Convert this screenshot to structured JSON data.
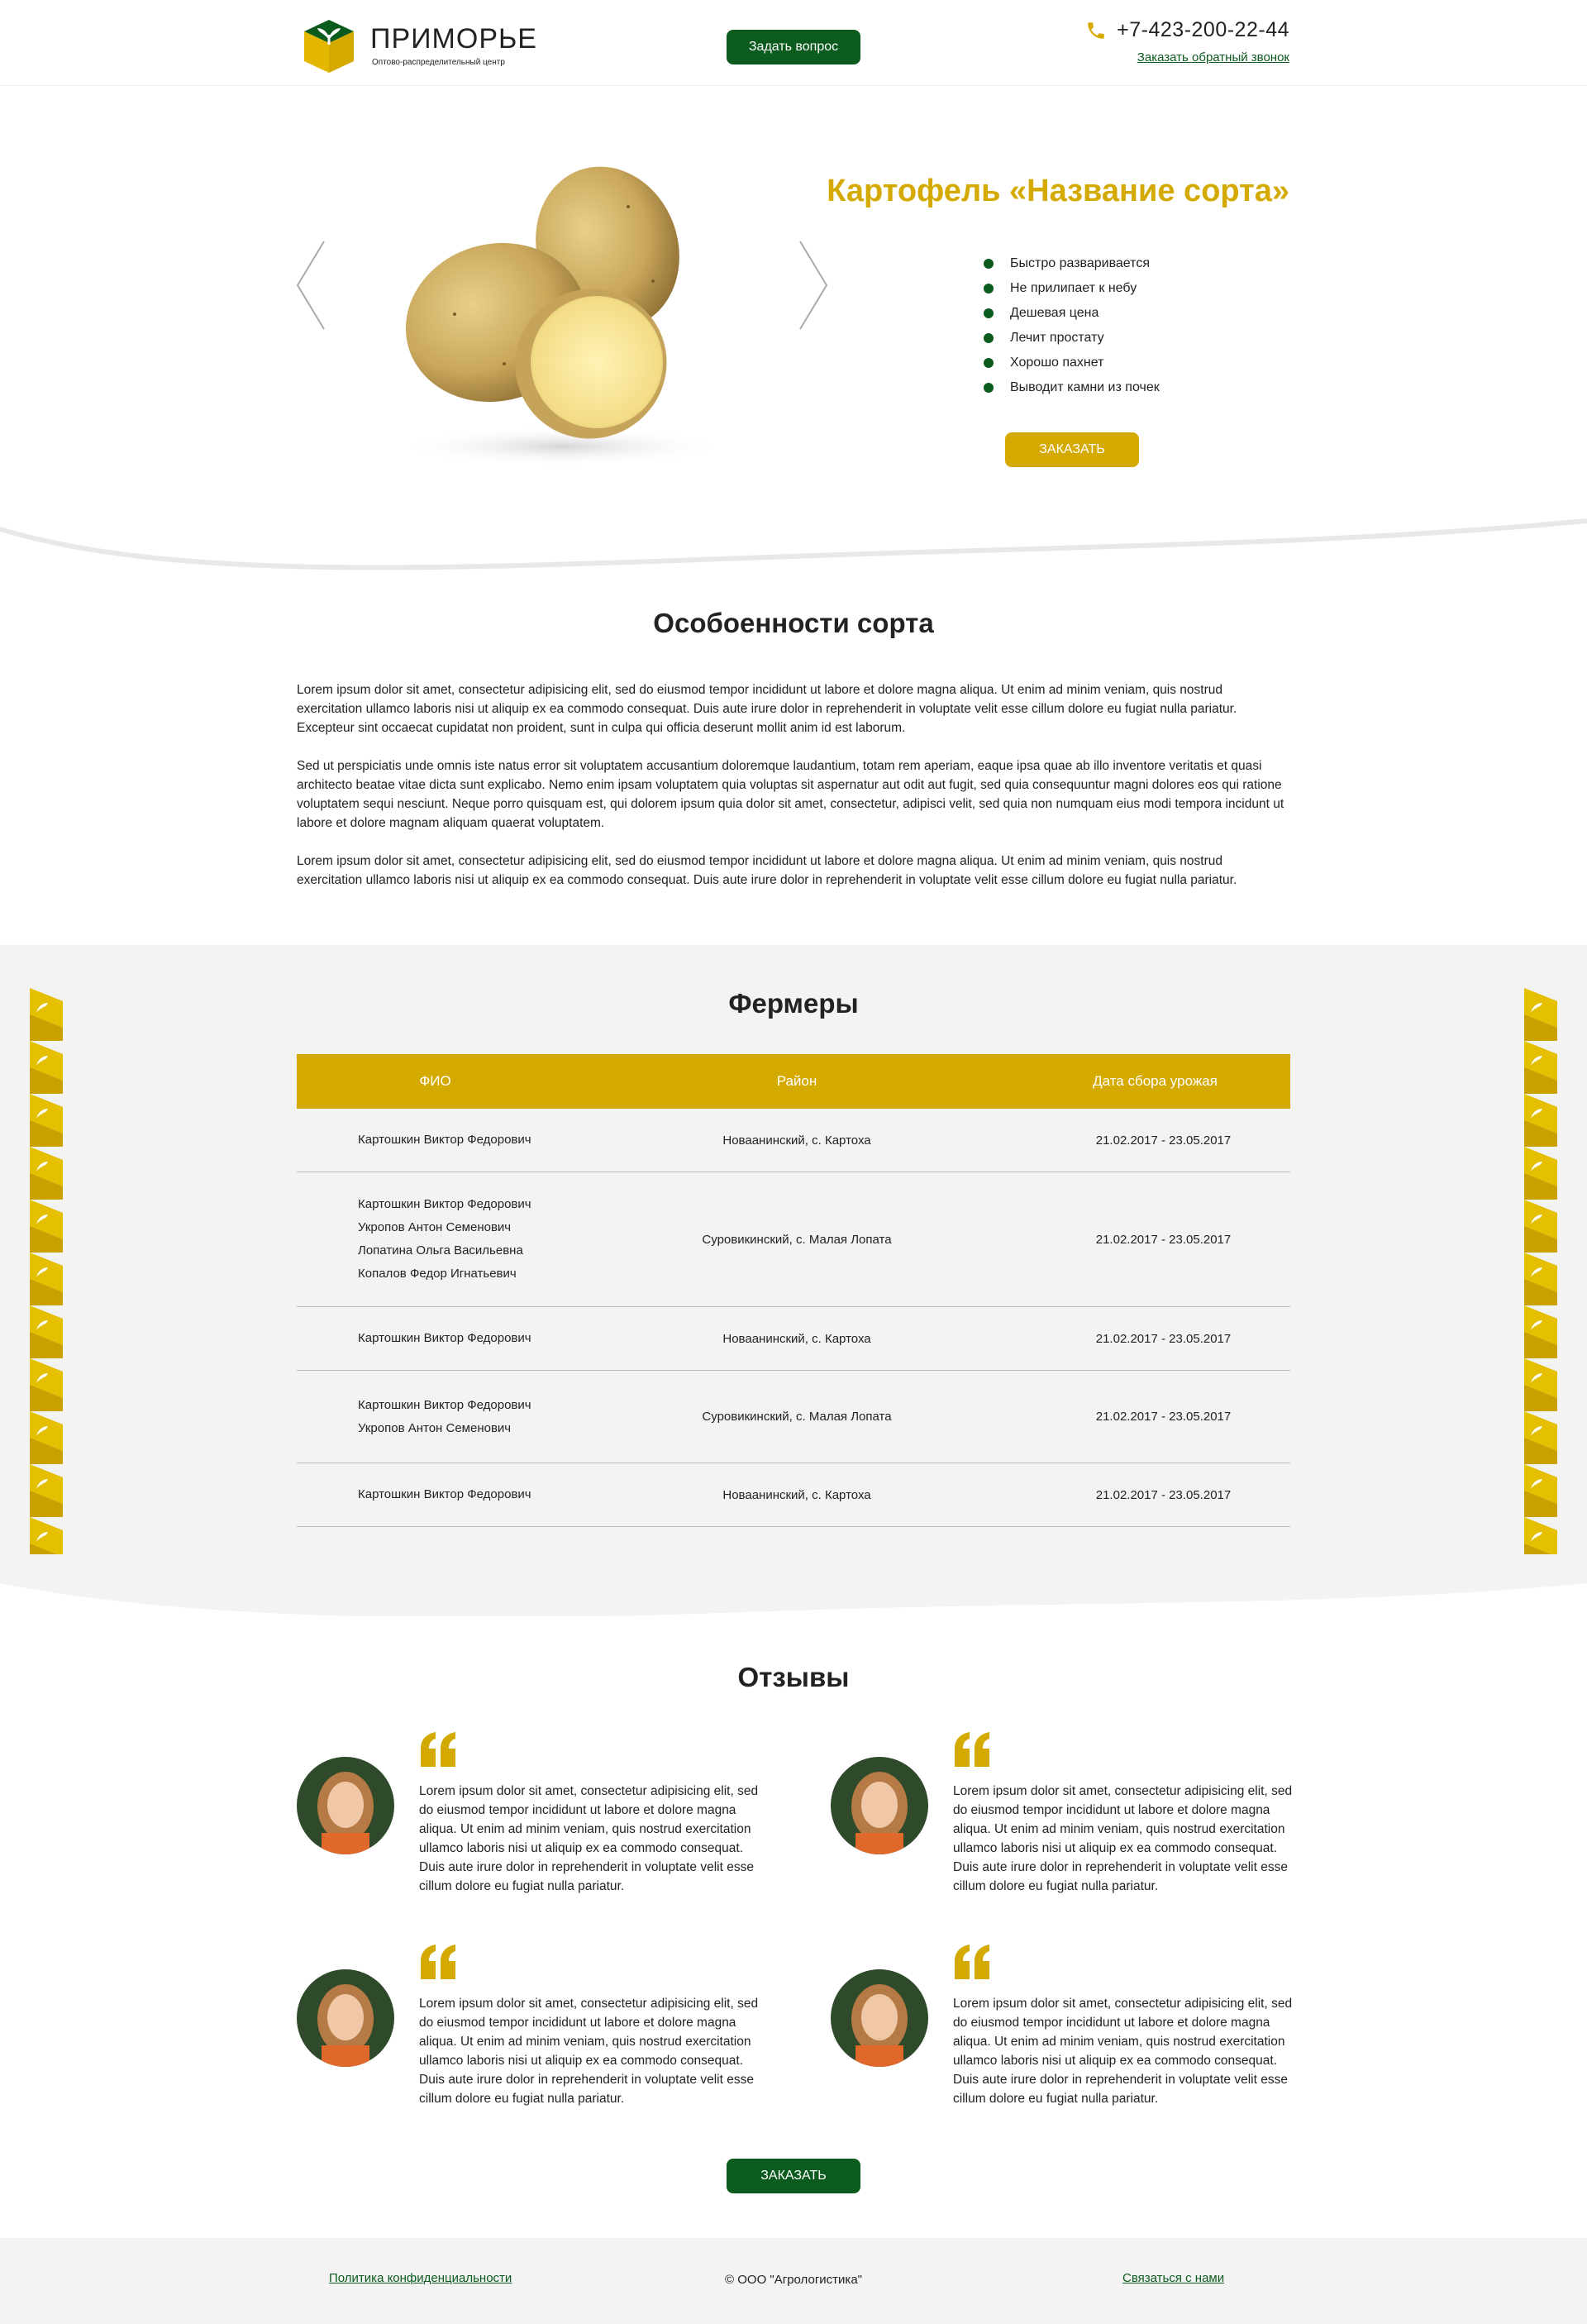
{
  "header": {
    "logo_title": "ПРИМОРЬЕ",
    "logo_subtitle": "Оптово-распределительный центр",
    "ask_button": "Задать вопрос",
    "phone": "+7-423-200-22-44",
    "callback_link": "Заказать обратный звонок"
  },
  "hero": {
    "title": "Картофель «Название сорта»",
    "features": [
      "Быстро разваривается",
      "Не прилипает к небу",
      "Дешевая цена",
      "Лечит простату",
      "Хорошо пахнет",
      "Выводит камни из почек"
    ],
    "order_button": "ЗАКАЗАТЬ"
  },
  "variety": {
    "title": "Особоенности сорта",
    "paragraphs": [
      "Lorem ipsum dolor sit amet, consectetur adipisicing elit, sed do eiusmod tempor incididunt ut labore et dolore magna aliqua. Ut enim ad minim veniam, quis nostrud exercitation ullamco laboris nisi ut aliquip ex ea commodo consequat. Duis aute irure dolor in reprehenderit in voluptate velit esse cillum dolore eu fugiat nulla pariatur. Excepteur sint occaecat cupidatat non proident, sunt in culpa qui officia deserunt mollit anim id est laborum.",
      "Sed ut perspiciatis unde omnis iste natus error sit voluptatem accusantium doloremque laudantium, totam rem aperiam, eaque ipsa quae ab illo inventore veritatis et quasi architecto beatae vitae dicta sunt explicabo. Nemo enim ipsam voluptatem quia voluptas sit aspernatur aut odit aut fugit, sed quia consequuntur magni dolores eos qui ratione voluptatem sequi nesciunt. Neque porro quisquam est, qui dolorem ipsum quia dolor sit amet, consectetur, adipisci velit, sed quia non numquam eius modi tempora incidunt ut labore et dolore magnam aliquam quaerat voluptatem.",
      "Lorem ipsum dolor sit amet, consectetur adipisicing elit, sed do eiusmod tempor incididunt ut labore et dolore magna aliqua. Ut enim ad minim veniam, quis nostrud exercitation ullamco laboris nisi ut aliquip ex ea commodo consequat. Duis aute irure dolor in reprehenderit in voluptate velit esse cillum dolore eu fugiat nulla pariatur."
    ]
  },
  "farmers": {
    "title": "Фермеры",
    "columns": [
      "ФИО",
      "Район",
      "Дата сбора урожая"
    ],
    "rows": [
      {
        "names": [
          "Картошкин Виктор Федорович"
        ],
        "district": "Новаанинский, с. Картоха",
        "dates": "21.02.2017 - 23.05.2017"
      },
      {
        "names": [
          "Картошкин Виктор Федорович",
          "Укропов Антон Семенович",
          "Лопатина Ольга Васильевна",
          "Копалов Федор Игнатьевич"
        ],
        "district": "Суровикинский, с. Малая Лопата",
        "dates": "21.02.2017 - 23.05.2017"
      },
      {
        "names": [
          "Картошкин Виктор Федорович"
        ],
        "district": "Новаанинский, с. Картоха",
        "dates": "21.02.2017 - 23.05.2017"
      },
      {
        "names": [
          "Картошкин Виктор Федорович",
          "Укропов Антон Семенович"
        ],
        "district": "Суровикинский, с. Малая Лопата",
        "dates": "21.02.2017 - 23.05.2017"
      },
      {
        "names": [
          "Картошкин Виктор Федорович"
        ],
        "district": "Новаанинский, с. Картоха",
        "dates": "21.02.2017 - 23.05.2017"
      }
    ]
  },
  "reviews": {
    "title": "Отзывы",
    "items": [
      {
        "text": "Lorem ipsum dolor sit amet, consectetur adipisicing elit, sed do eiusmod tempor incididunt ut labore et dolore magna aliqua. Ut enim ad minim veniam, quis nostrud exercitation ullamco laboris nisi ut aliquip ex ea commodo consequat. Duis aute irure dolor in reprehenderit in voluptate velit esse cillum dolore eu fugiat nulla pariatur."
      },
      {
        "text": "Lorem ipsum dolor sit amet, consectetur adipisicing elit, sed do eiusmod tempor incididunt ut labore et dolore magna aliqua. Ut enim ad minim veniam, quis nostrud exercitation ullamco laboris nisi ut aliquip ex ea commodo consequat. Duis aute irure dolor in reprehenderit in voluptate velit esse cillum dolore eu fugiat nulla pariatur."
      },
      {
        "text": "Lorem ipsum dolor sit amet, consectetur adipisicing elit, sed do eiusmod tempor incididunt ut labore et dolore magna aliqua. Ut enim ad minim veniam, quis nostrud exercitation ullamco laboris nisi ut aliquip ex ea commodo consequat. Duis aute irure dolor in reprehenderit in voluptate velit esse cillum dolore eu fugiat nulla pariatur."
      },
      {
        "text": "Lorem ipsum dolor sit amet, consectetur adipisicing elit, sed do eiusmod tempor incididunt ut labore et dolore magna aliqua. Ut enim ad minim veniam, quis nostrud exercitation ullamco laboris nisi ut aliquip ex ea commodo consequat. Duis aute irure dolor in reprehenderit in voluptate velit esse cillum dolore eu fugiat nulla pariatur."
      }
    ],
    "order_button": "ЗАКАЗАТЬ"
  },
  "footer": {
    "privacy": "Политика конфиденциальности",
    "copyright": "© ООО \"Агрологистика\"",
    "contact": "Связаться с нами"
  },
  "colors": {
    "brand_green": "#0b5a1e",
    "brand_yellow": "#d4a900",
    "section_gray": "#f3f3f3"
  }
}
